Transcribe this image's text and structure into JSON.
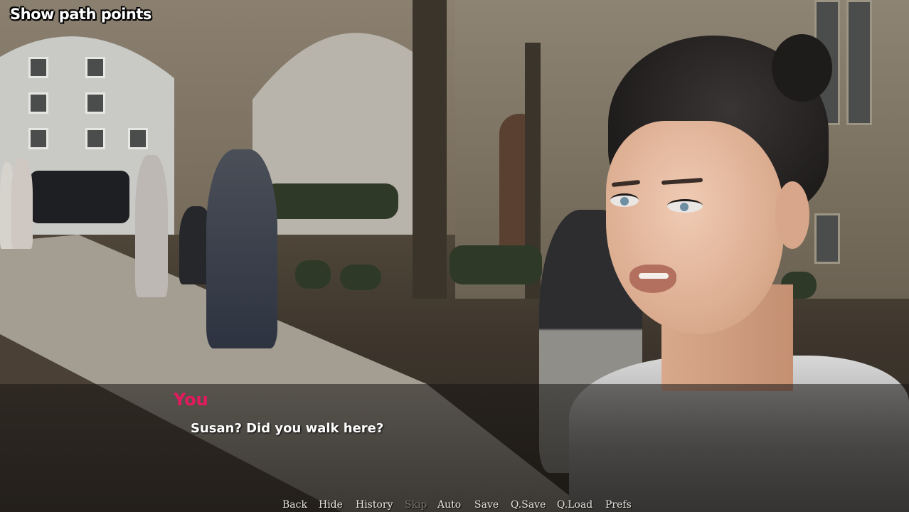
{
  "overlay": {
    "show_path_points": "Show path points"
  },
  "dialogue": {
    "speaker": "You",
    "text": "Susan? Did you walk here?",
    "speaker_color": "#e5195e"
  },
  "quick_menu": {
    "back": "Back",
    "hide": "Hide",
    "history": "History",
    "skip": "Skip",
    "auto": "Auto",
    "save": "Save",
    "qsave": "Q.Save",
    "qload": "Q.Load",
    "prefs": "Prefs"
  }
}
